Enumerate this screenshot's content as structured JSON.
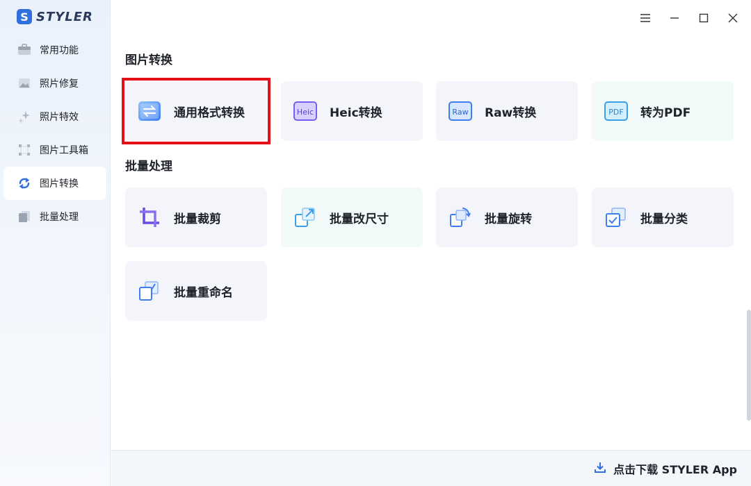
{
  "app": {
    "logo_letter": "S",
    "name": "STYLER"
  },
  "sidebar": {
    "items": [
      {
        "label": "常用功能",
        "icon": "briefcase-icon"
      },
      {
        "label": "照片修复",
        "icon": "photo-icon"
      },
      {
        "label": "照片特效",
        "icon": "sparkle-icon"
      },
      {
        "label": "图片工具箱",
        "icon": "crop-frame-icon"
      },
      {
        "label": "图片转换",
        "icon": "convert-icon",
        "active": true
      },
      {
        "label": "批量处理",
        "icon": "stack-icon"
      }
    ]
  },
  "sections": {
    "convert": {
      "title": "图片转换",
      "cards": [
        {
          "label": "通用格式转换",
          "icon": "swap-arrows-icon"
        },
        {
          "label": "Heic转换",
          "icon": "heic-icon",
          "badge": "Heic"
        },
        {
          "label": "Raw转换",
          "icon": "raw-icon",
          "badge": "Raw"
        },
        {
          "label": "转为PDF",
          "icon": "pdf-icon",
          "badge": "PDF"
        }
      ]
    },
    "batch": {
      "title": "批量处理",
      "cards": [
        {
          "label": "批量裁剪",
          "icon": "crop-icon"
        },
        {
          "label": "批量改尺寸",
          "icon": "resize-icon"
        },
        {
          "label": "批量旋转",
          "icon": "rotate-icon"
        },
        {
          "label": "批量分类",
          "icon": "classify-icon"
        },
        {
          "label": "批量重命名",
          "icon": "rename-icon"
        }
      ]
    }
  },
  "footer": {
    "download_label": "点击下载 STYLER App"
  },
  "colors": {
    "accent": "#2f6fe0",
    "highlight": "#e3101c",
    "purple": "#7b5cf0"
  }
}
